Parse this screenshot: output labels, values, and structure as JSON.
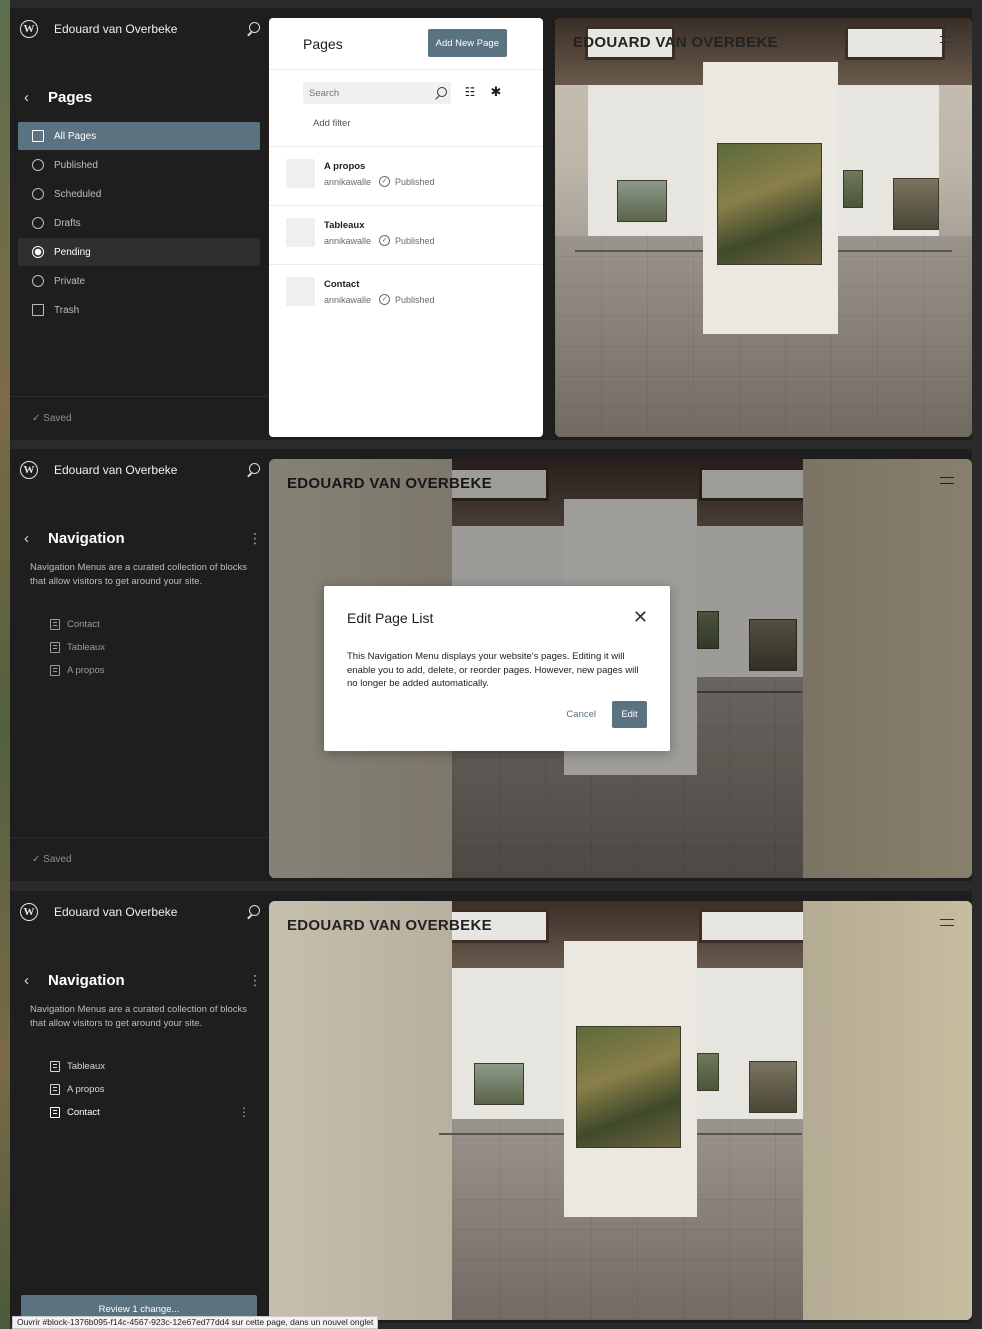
{
  "site": {
    "name": "Edouard van Overbeke",
    "display_title": "EDOUARD VAN OVERBEKE"
  },
  "panel1": {
    "section_title": "Pages",
    "menu": [
      {
        "label": "All Pages",
        "icon": "pages-icon"
      },
      {
        "label": "Published",
        "icon": "published-icon"
      },
      {
        "label": "Scheduled",
        "icon": "scheduled-icon"
      },
      {
        "label": "Drafts",
        "icon": "drafts-icon"
      },
      {
        "label": "Pending",
        "icon": "pending-icon"
      },
      {
        "label": "Private",
        "icon": "private-icon"
      },
      {
        "label": "Trash",
        "icon": "trash-icon"
      }
    ],
    "footer": "✓  Saved",
    "pages": {
      "title": "Pages",
      "add_button": "Add New Page",
      "search_placeholder": "Search",
      "add_filter": "Add filter",
      "rows": [
        {
          "title": "A propos",
          "author": "annikawalle",
          "status": "Published"
        },
        {
          "title": "Tableaux",
          "author": "annikawalle",
          "status": "Published"
        },
        {
          "title": "Contact",
          "author": "annikawalle",
          "status": "Published"
        }
      ]
    }
  },
  "panel2": {
    "section_title": "Navigation",
    "description": "Navigation Menus are a curated collection of blocks that allow visitors to get around your site.",
    "items": [
      "Contact",
      "Tableaux",
      "A propos"
    ],
    "footer": "✓  Saved",
    "modal": {
      "title": "Edit Page List",
      "body": "This Navigation Menu displays your website's pages. Editing it will enable you to add, delete, or reorder pages. However, new pages will no longer be added automatically.",
      "cancel": "Cancel",
      "edit": "Edit"
    }
  },
  "panel3": {
    "section_title": "Navigation",
    "description": "Navigation Menus are a curated collection of blocks that allow visitors to get around your site.",
    "items": [
      "Tableaux",
      "A propos",
      "Contact"
    ],
    "review_button": "Review 1 change..."
  },
  "status_bar": "Ouvrir #block-1376b095-f14c-4567-923c-12e67ed77dd4 sur cette page, dans un nouvel onglet",
  "colors": {
    "accent": "#5b7281",
    "sidebar_bg": "#1e1e1e"
  }
}
